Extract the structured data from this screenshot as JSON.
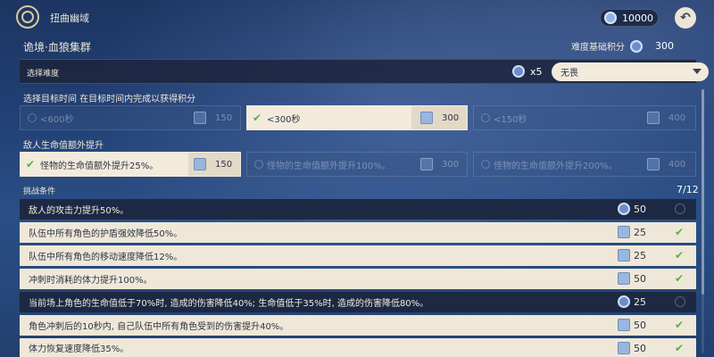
{
  "header": {
    "title": "扭曲幽域",
    "currency": "10000",
    "back_icon": "back-arrow-icon"
  },
  "domain": {
    "name": "诡境·血狼集群",
    "base_score_label": "难度基础积分",
    "base_score_value": "300"
  },
  "difficulty": {
    "label": "选择难度",
    "multiplier": "x5",
    "selected": "无畏"
  },
  "time_target": {
    "label": "选择目标时间 在目标时间内完成以获得积分",
    "options": [
      {
        "label": "<600秒",
        "points": "150",
        "selected": false
      },
      {
        "label": "<300秒",
        "points": "300",
        "selected": true
      },
      {
        "label": "<150秒",
        "points": "400",
        "selected": false
      }
    ]
  },
  "hp_boost": {
    "label": "敌人生命值额外提升",
    "options": [
      {
        "label": "怪物的生命值额外提升25%。",
        "points": "150",
        "selected": true
      },
      {
        "label": "怪物的生命值额外提升100%。",
        "points": "300",
        "selected": false
      },
      {
        "label": "怪物的生命值额外提升200%。",
        "points": "400",
        "selected": false
      }
    ]
  },
  "challenges": {
    "label": "挑战条件",
    "count": "7/12",
    "rows": [
      {
        "text": "敌人的攻击力提升50%。",
        "points": "50",
        "active": false
      },
      {
        "text": "队伍中所有角色的护盾强效降低50%。",
        "points": "25",
        "active": true
      },
      {
        "text": "队伍中所有角色的移动速度降低12%。",
        "points": "25",
        "active": true
      },
      {
        "text": "冲刺时消耗的体力提升100%。",
        "points": "50",
        "active": true
      },
      {
        "text": "当前场上角色的生命值低于70%时, 造成的伤害降低40%; 生命值低于35%时, 造成的伤害降低80%。",
        "points": "25",
        "active": false
      },
      {
        "text": "角色冲刺后的10秒内, 自己队伍中所有角色受到的伤害提升40%。",
        "points": "50",
        "active": true
      },
      {
        "text": "体力恢复速度降低35%。",
        "points": "50",
        "active": true
      }
    ]
  }
}
